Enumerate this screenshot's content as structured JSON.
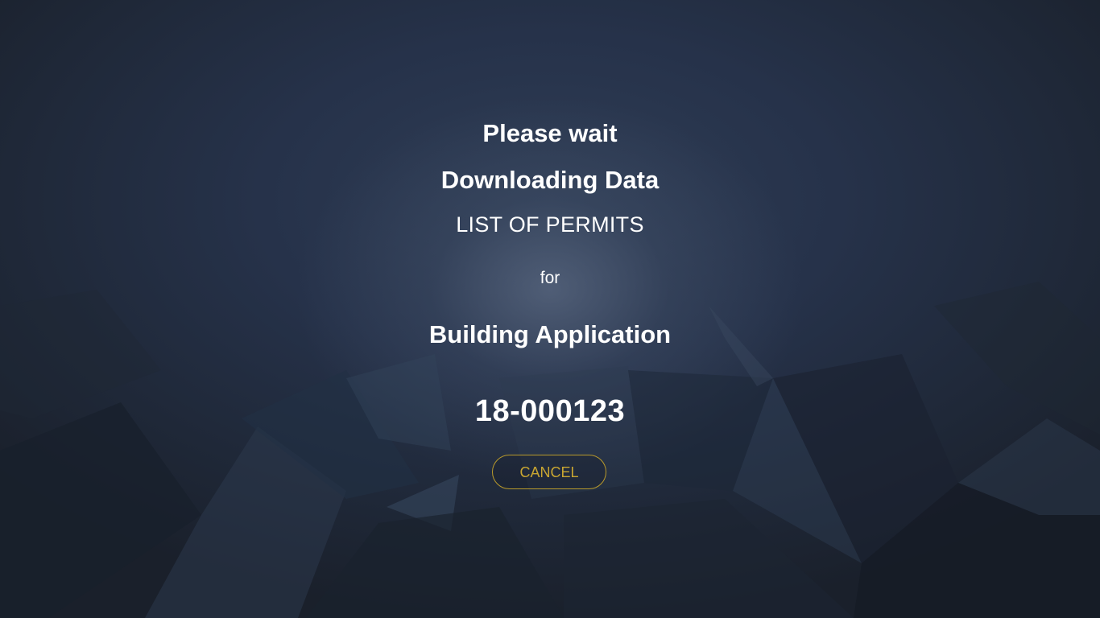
{
  "loading_dialog": {
    "wait_label": "Please wait",
    "status_label": "Downloading Data",
    "data_type_label": "LIST OF PERMITS",
    "for_label": "for",
    "application_type": "Building Application",
    "application_number": "18-000123",
    "cancel_label": "CANCEL"
  },
  "colors": {
    "background_dark": "#1c2431",
    "text": "#ffffff",
    "accent_gold": "#c9a631"
  }
}
